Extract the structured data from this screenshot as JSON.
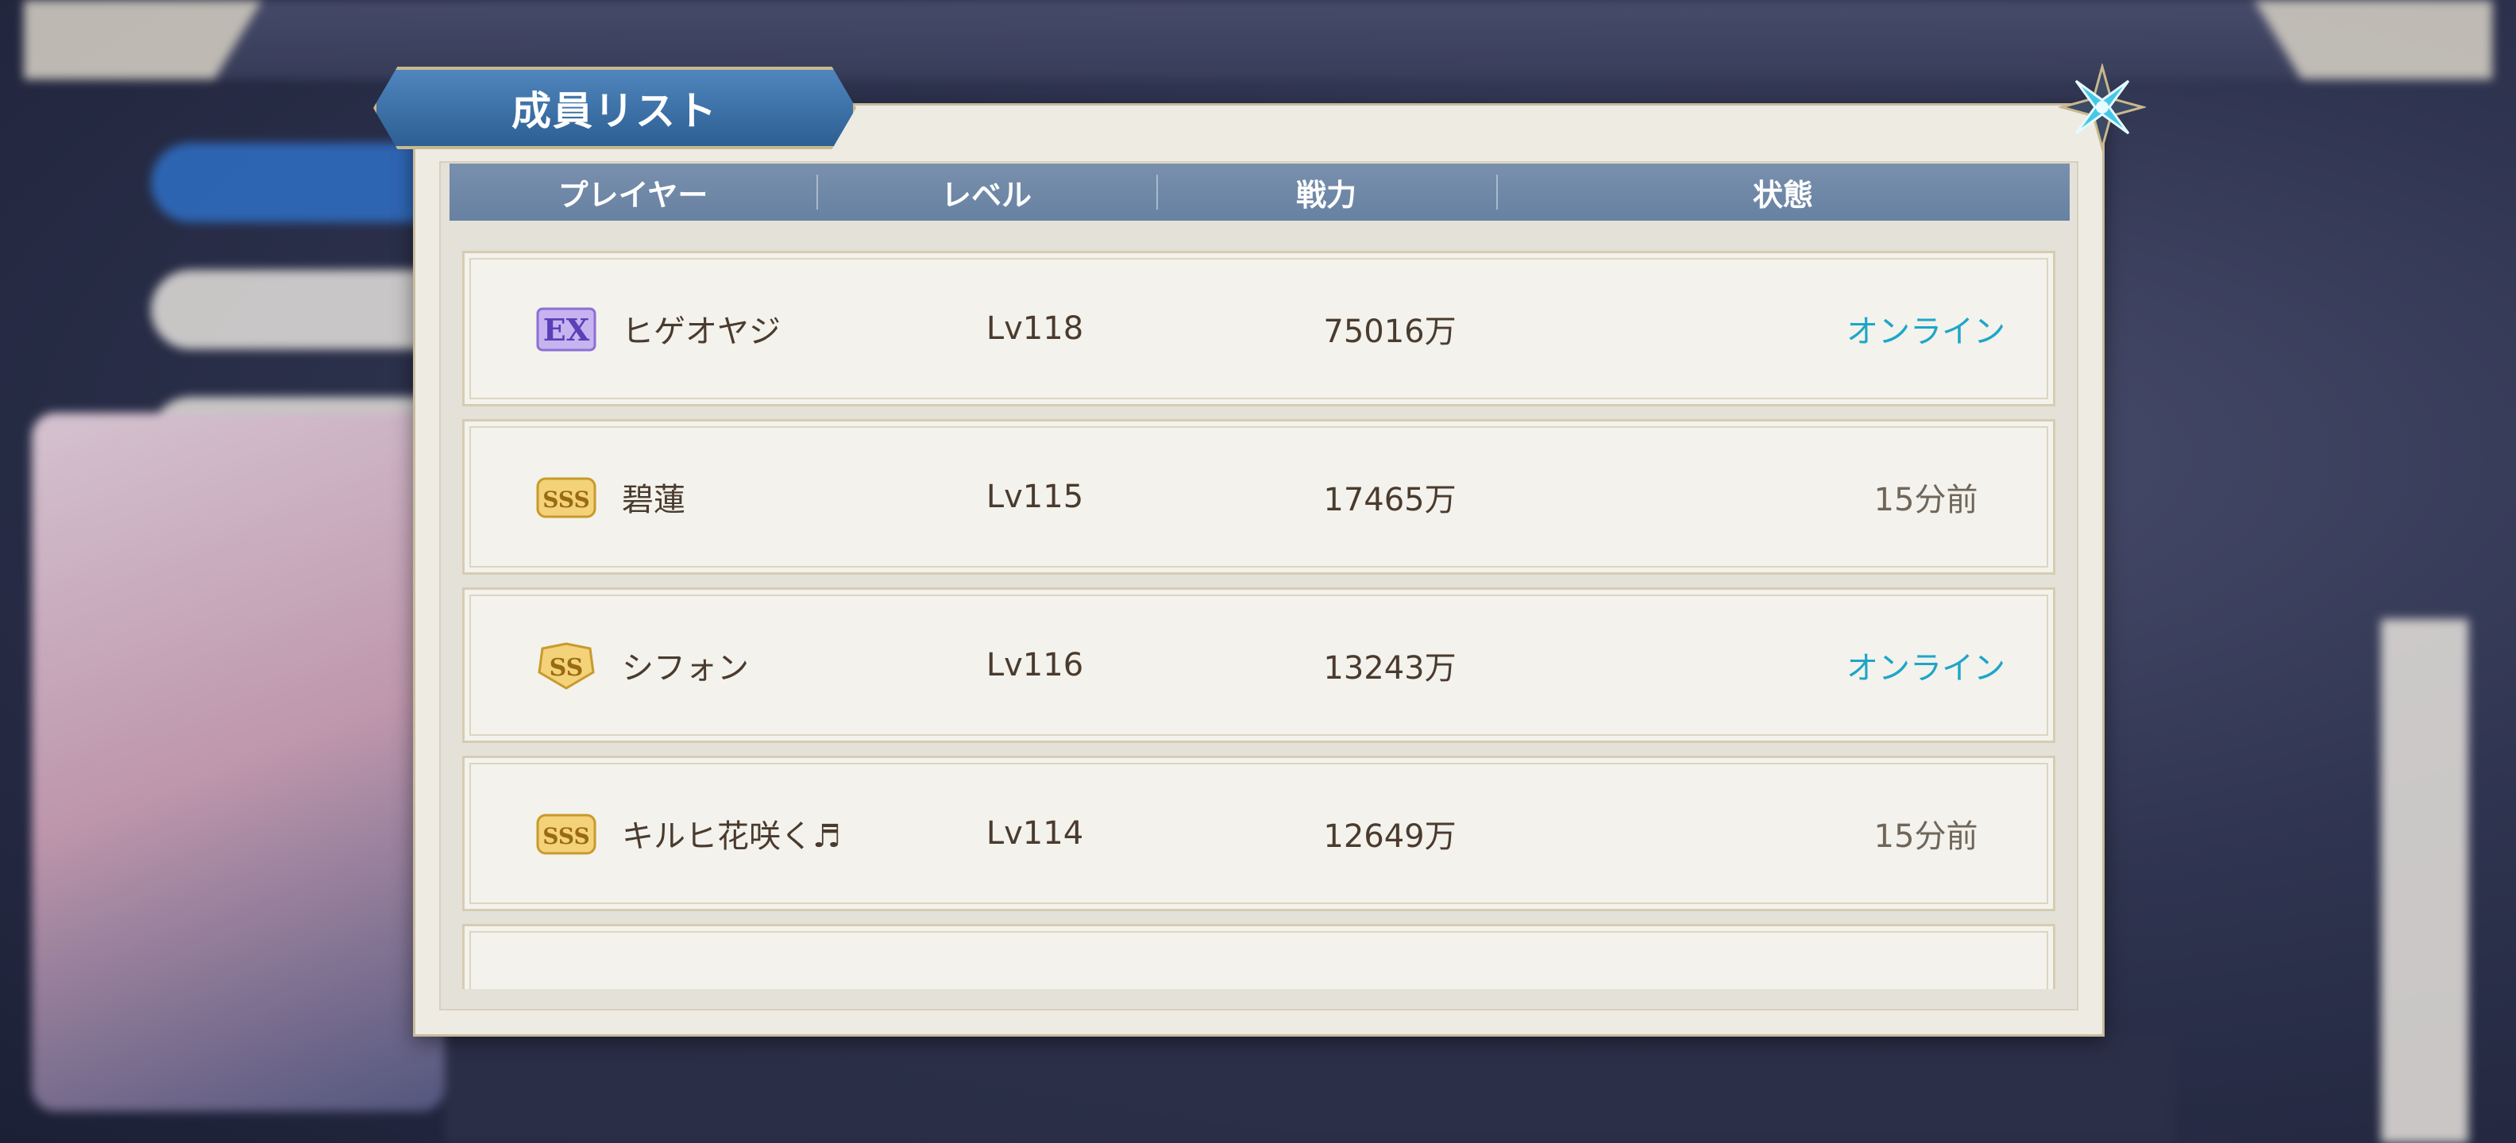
{
  "dialog": {
    "title": "成員リスト"
  },
  "columns": {
    "player": "プレイヤー",
    "level": "レベル",
    "power": "戦力",
    "status": "状態"
  },
  "members": [
    {
      "rank": "EX",
      "name": "ヒゲオヤジ",
      "level": "Lv118",
      "power": "75016万",
      "status": "オンライン",
      "online": true
    },
    {
      "rank": "SSS",
      "name": "碧蓮",
      "level": "Lv115",
      "power": "17465万",
      "status": "15分前",
      "online": false
    },
    {
      "rank": "SS",
      "name": "シフォン",
      "level": "Lv116",
      "power": "13243万",
      "status": "オンライン",
      "online": true
    },
    {
      "rank": "SSS",
      "name": "キルヒ花咲く♬",
      "level": "Lv114",
      "power": "12649万",
      "status": "15分前",
      "online": false
    }
  ],
  "colors": {
    "online": "#1ea6c8",
    "offline": "#6f6659",
    "header": "#6f88a8",
    "title_tab": "#3b6ea4"
  }
}
